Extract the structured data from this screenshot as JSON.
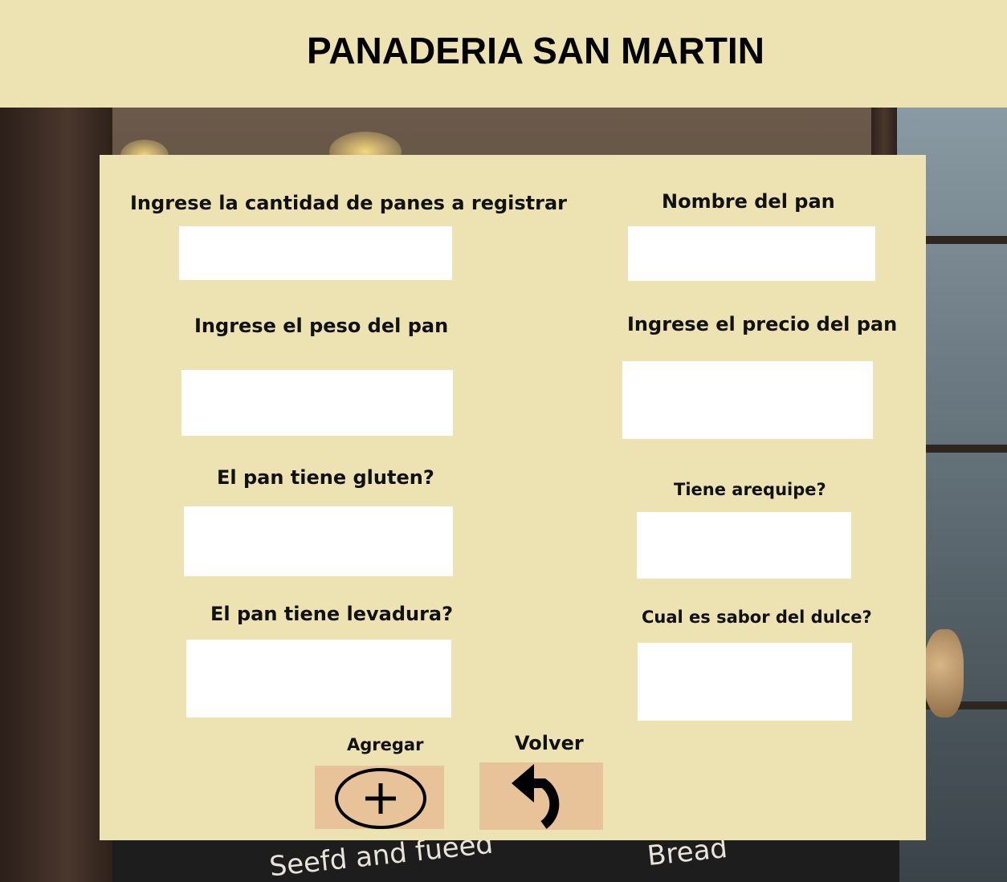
{
  "header": {
    "title": "PANADERIA SAN MARTIN"
  },
  "background": {
    "chalk_left": "Seefd  and fueed",
    "chalk_right": "Bread"
  },
  "form": {
    "fields": [
      {
        "label": "Ingrese la cantidad de panes a registrar",
        "value": "",
        "placeholder": ""
      },
      {
        "label": "Nombre del pan",
        "value": "",
        "placeholder": ""
      },
      {
        "label": "Ingrese el peso del pan",
        "value": "",
        "placeholder": ""
      },
      {
        "label": "Ingrese el precio del pan",
        "value": "",
        "placeholder": ""
      },
      {
        "label": "El pan tiene gluten?",
        "value": "",
        "placeholder": ""
      },
      {
        "label": "Tiene arequipe?",
        "value": "",
        "placeholder": ""
      },
      {
        "label": "El pan tiene levadura?",
        "value": "",
        "placeholder": ""
      },
      {
        "label": "Cual es sabor del dulce?",
        "value": "",
        "placeholder": ""
      }
    ]
  },
  "actions": {
    "add_label": "Agregar",
    "add_icon": "circle-plus-icon",
    "back_label": "Volver",
    "back_icon": "undo-arrow-icon"
  },
  "colors": {
    "panel": "#ede3b2",
    "button": "#e8c298"
  }
}
